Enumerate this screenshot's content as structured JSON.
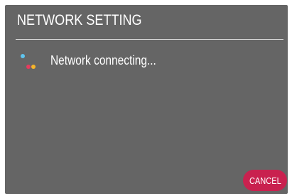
{
  "dialog": {
    "title": "NETWORK SETTING",
    "status_text": "Network connecting...",
    "spinner_icon": "loading-dots-icon",
    "cancel_label": "CANCEL"
  },
  "colors": {
    "dialog_background": "#656565",
    "cancel_button": "#c9214f",
    "dot_blue": "#5fc4ee",
    "dot_red": "#e73b5e",
    "dot_yellow": "#f5b52a"
  }
}
